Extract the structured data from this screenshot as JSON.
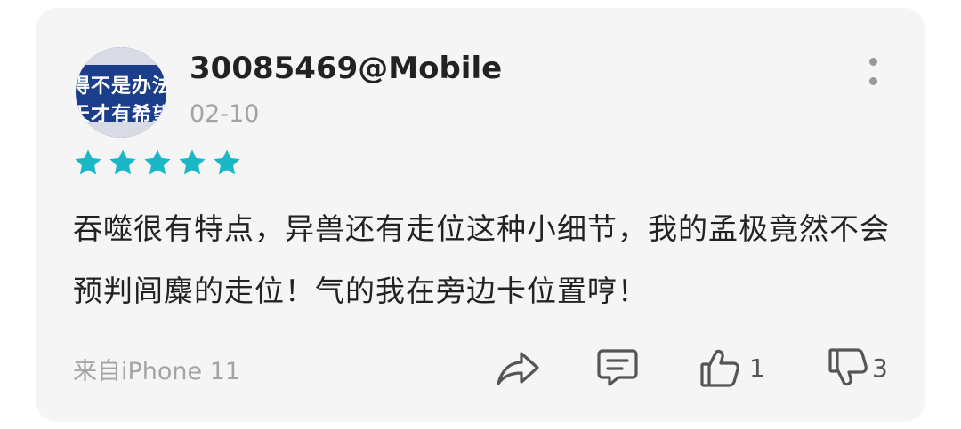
{
  "comment": {
    "username": "30085469@Mobile",
    "date": "02-10",
    "rating": 5,
    "avatar_text": [
      "得不是办法",
      "天才有希望"
    ],
    "text": "吞噬很有特点，异兽还有走位这种小细节，我的孟极竟然不会预判闾麋的走位！气的我在旁边卡位置哼！",
    "source": "来自iPhone 11",
    "star_color": "#1ab7c7"
  },
  "actions": {
    "share_icon": "share-icon",
    "reply_icon": "comment-icon",
    "like_icon": "thumbs-up-icon",
    "like_count": "1",
    "dislike_icon": "thumbs-down-icon",
    "dislike_count": "3"
  }
}
